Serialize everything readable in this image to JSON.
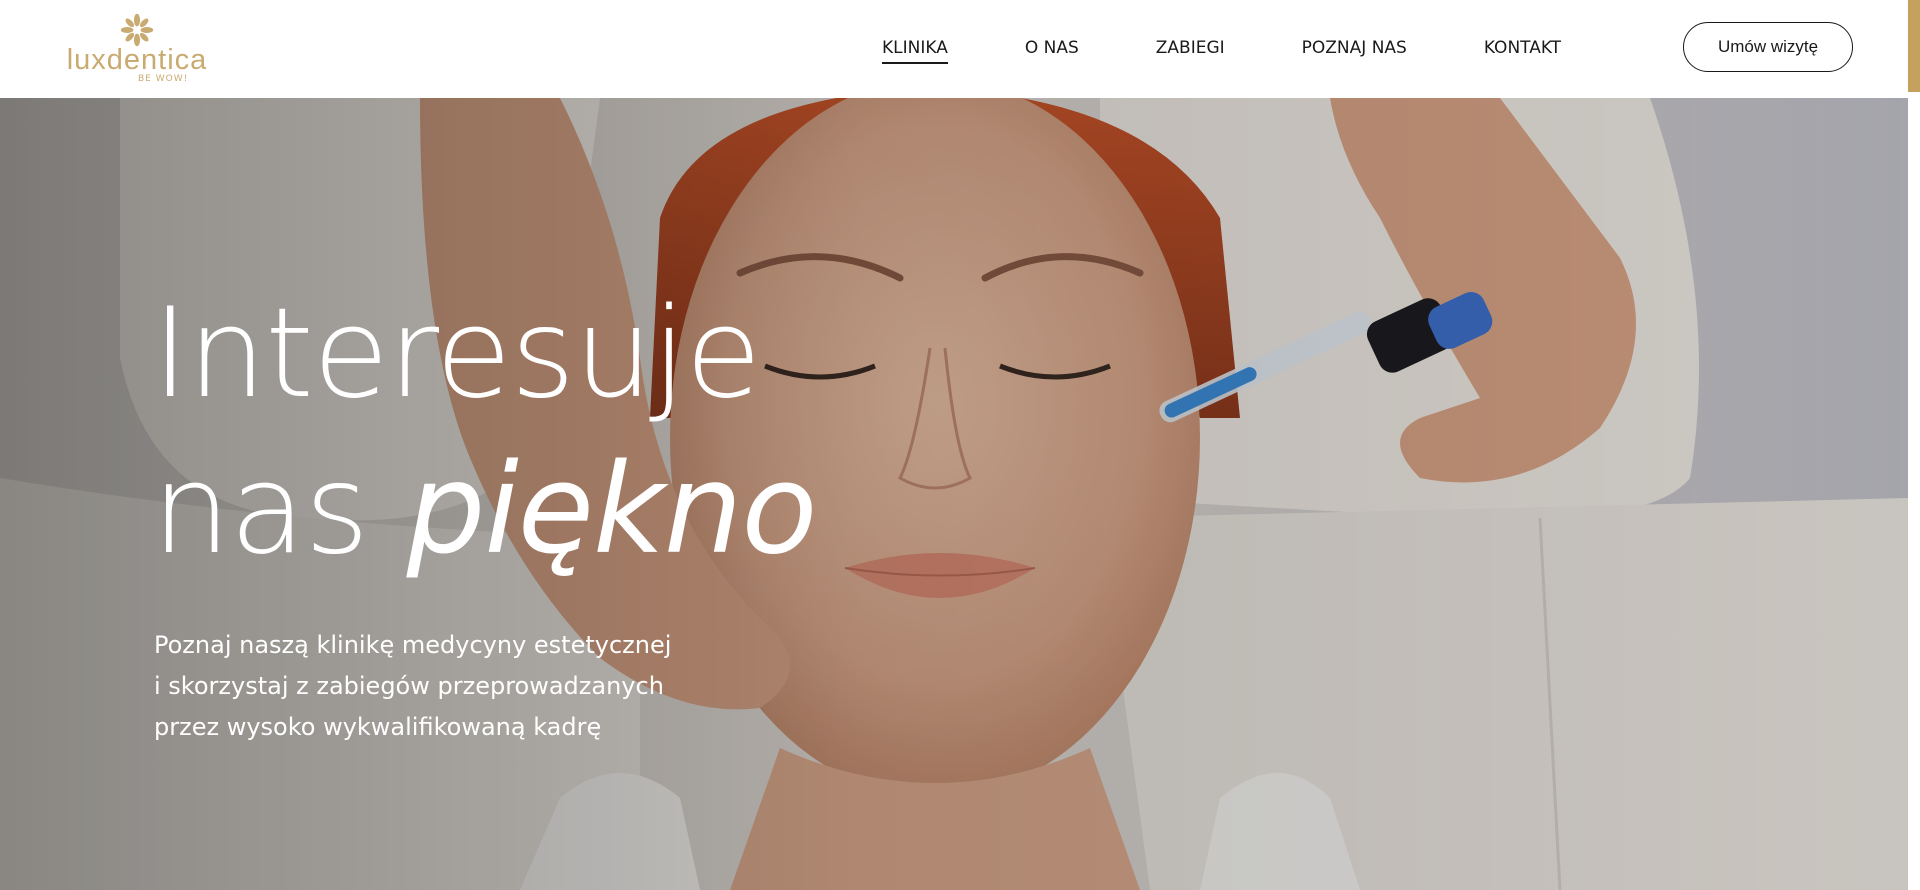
{
  "logo": {
    "wordmark": "luxdentica",
    "tagline": "BE WOW!",
    "icon": "flower-icon",
    "color": "#c9ab72"
  },
  "nav": {
    "items": [
      {
        "label": "KLINIKA",
        "active": true
      },
      {
        "label": "O NAS",
        "active": false
      },
      {
        "label": "ZABIEGI",
        "active": false
      },
      {
        "label": "POZNAJ NAS",
        "active": false
      },
      {
        "label": "KONTAKT",
        "active": false
      }
    ]
  },
  "cta": {
    "label": "Umów wizytę"
  },
  "hero": {
    "title_line1": "Interesuje",
    "title_line2_plain": "nas ",
    "title_line2_italic": "piękno",
    "subtitle_lines": [
      "Poznaj naszą klinikę medycyny estetycznej",
      "i skorzystaj z zabiegów przeprowadzanych",
      "przez wysoko wykwalifikowaną kadrę"
    ],
    "image": "woman-facial-treatment-photo"
  },
  "colors": {
    "accent": "#c5a15e",
    "text_dark": "#1a1a1a",
    "hero_text": "#ffffff"
  }
}
